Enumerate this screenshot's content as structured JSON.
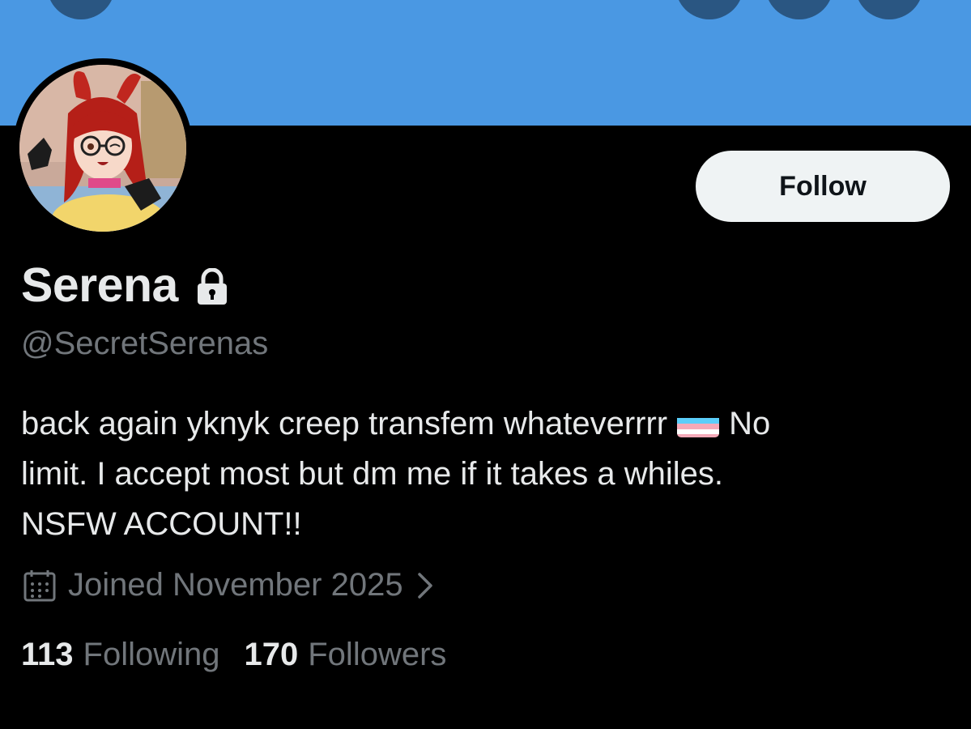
{
  "profile": {
    "display_name": "Serena",
    "handle": "@SecretSerenas",
    "bio_line1_before_flag": "back again yknyk creep transfem whateverrrr",
    "bio_line1_after_flag": "No",
    "bio_line2": "limit. I accept most but dm me if it takes a whiles.",
    "bio_line3": "NSFW ACCOUNT!!",
    "joined": "Joined November 2025",
    "following_count": "113",
    "following_label": "Following",
    "followers_count": "170",
    "followers_label": "Followers"
  },
  "actions": {
    "follow_label": "Follow"
  },
  "icons": {
    "lock": "lock-icon",
    "calendar": "calendar-icon",
    "chevron": "chevron-right-icon",
    "flag": "transgender-flag-emoji"
  },
  "colors": {
    "banner": "#4a98e3",
    "background": "#000000",
    "text_primary": "#e7e9ea",
    "text_secondary": "#71767b",
    "follow_button_bg": "#eff3f4",
    "follow_button_text": "#0f1419"
  }
}
